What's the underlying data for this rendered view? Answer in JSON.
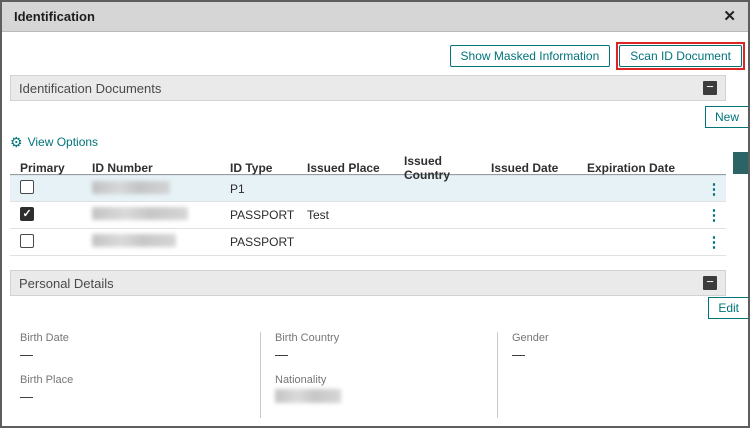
{
  "modal": {
    "title": "Identification"
  },
  "icons": {
    "close": "✕",
    "collapse": "−",
    "kebab": "⋮",
    "gear": "⚙"
  },
  "toolbar": {
    "show_masked_label": "Show Masked Information",
    "scan_id_label": "Scan ID Document"
  },
  "documents": {
    "title": "Identification Documents",
    "new_label": "New",
    "view_options_label": "View Options",
    "headers": {
      "primary": "Primary",
      "id_number": "ID Number",
      "id_type": "ID Type",
      "issued_place": "Issued Place",
      "issued_country": "Issued Country",
      "issued_date": "Issued Date",
      "expiration_date": "Expiration Date"
    },
    "rows": [
      {
        "primary": false,
        "highlighted": true,
        "id_number_masked": true,
        "id_type": "P1",
        "issued_place": "",
        "issued_country": "",
        "issued_date": "",
        "expiration_date": ""
      },
      {
        "primary": true,
        "highlighted": false,
        "id_number_masked": true,
        "id_type": "PASSPORT",
        "issued_place": "Test",
        "issued_country": "",
        "issued_date": "",
        "expiration_date": ""
      },
      {
        "primary": false,
        "highlighted": false,
        "id_number_masked": true,
        "id_type": "PASSPORT",
        "issued_place": "",
        "issued_country": "",
        "issued_date": "",
        "expiration_date": ""
      }
    ]
  },
  "personal": {
    "title": "Personal Details",
    "edit_label": "Edit",
    "birth_date_label": "Birth Date",
    "birth_date_value": "—",
    "birth_place_label": "Birth Place",
    "birth_place_value": "—",
    "birth_country_label": "Birth Country",
    "birth_country_value": "—",
    "nationality_label": "Nationality",
    "nationality_masked": true,
    "gender_label": "Gender",
    "gender_value": "—"
  },
  "colors": {
    "teal": "#00747A",
    "row_highlight": "#e7f2f7",
    "annotation_red": "#e02424"
  }
}
